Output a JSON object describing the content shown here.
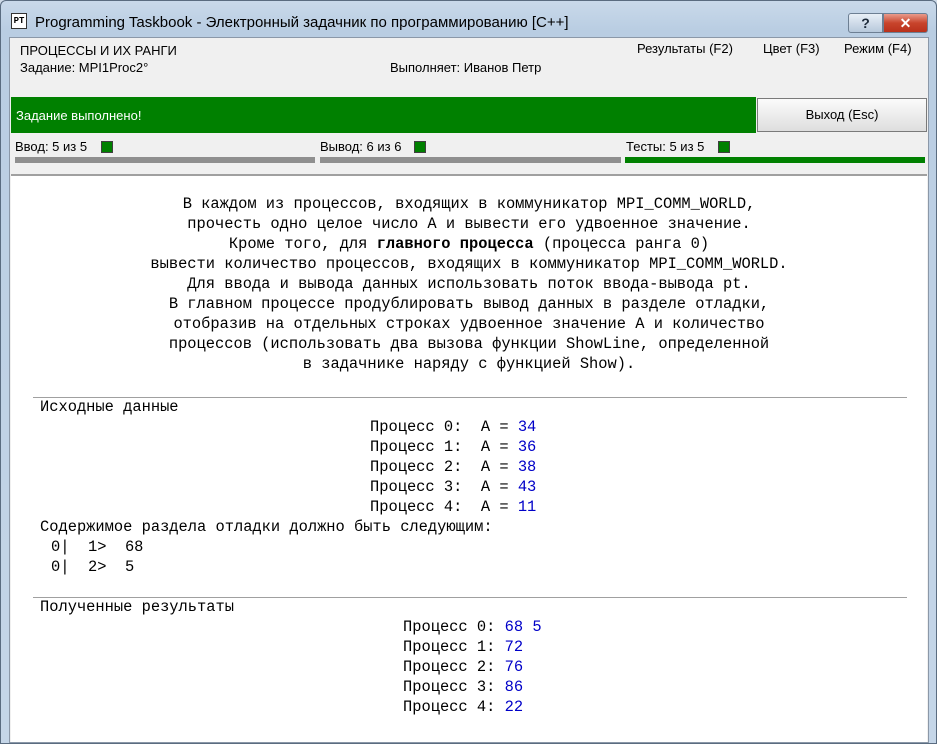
{
  "window": {
    "title": "Programming Taskbook - Электронный задачник по программированию [C++]",
    "icon_text": "PT",
    "help_button": "?",
    "close_button": "✕"
  },
  "header": {
    "group_title": "ПРОЦЕССЫ И ИХ РАНГИ",
    "task_label": "Задание: MPI1Proc2°",
    "student_label": "Выполняет: Иванов Петр",
    "menu": {
      "results": "Результаты (F2)",
      "color": "Цвет (F3)",
      "mode": "Режим (F4)"
    }
  },
  "status": {
    "message": "Задание выполнено!",
    "bar_color": "#008000",
    "exit_button": "Выход (Esc)"
  },
  "counters": {
    "input": {
      "label": "Ввод: 5 из 5",
      "filled": 5,
      "total": 5
    },
    "output": {
      "label": "Вывод: 6 из 6",
      "filled": 6,
      "total": 6
    },
    "tests": {
      "label": "Тесты: 5 из 5",
      "filled": 5,
      "total": 5
    }
  },
  "task": {
    "line1": "В каждом из процессов, входящих в коммуникатор MPI_COMM_WORLD,",
    "line2": "прочесть одно целое число A и вывести его удвоенное значение.",
    "line3_prefix": "Кроме того, для ",
    "line3_bold": "главного процесса",
    "line3_suffix": " (процесса ранга 0)",
    "line4": "вывести количество процессов, входящих в коммуникатор MPI_COMM_WORLD.",
    "line5": "Для ввода и вывода данных использовать поток ввода-вывода pt.",
    "line6": "В главном процессе продублировать вывод данных в разделе отладки,",
    "line7": "отобразив на отдельных строках удвоенное значение A и количество",
    "line8": "процессов (использовать два вызова функции ShowLine, определенной",
    "line9": "в задачнике наряду с функцией Show)."
  },
  "input_section": {
    "title": "Исходные данные",
    "rows": [
      {
        "label": "Процесс 0:",
        "var": "A =",
        "value": "34"
      },
      {
        "label": "Процесс 1:",
        "var": "A =",
        "value": "36"
      },
      {
        "label": "Процесс 2:",
        "var": "A =",
        "value": "38"
      },
      {
        "label": "Процесс 3:",
        "var": "A =",
        "value": "43"
      },
      {
        "label": "Процесс 4:",
        "var": "A =",
        "value": "11"
      }
    ],
    "debug_title": "Содержимое раздела отладки должно быть следующим:",
    "debug_lines": [
      {
        "proc": "0|",
        "num": "1>",
        "text": "68"
      },
      {
        "proc": "0|",
        "num": "2>",
        "text": "5"
      }
    ]
  },
  "result_section": {
    "title": "Полученные результаты",
    "rows": [
      {
        "label": "Процесс 0:",
        "value": "68 5"
      },
      {
        "label": "Процесс 1:",
        "value": "72"
      },
      {
        "label": "Процесс 2:",
        "value": "76"
      },
      {
        "label": "Процесс 3:",
        "value": "86"
      },
      {
        "label": "Процесс 4:",
        "value": "22"
      }
    ]
  }
}
